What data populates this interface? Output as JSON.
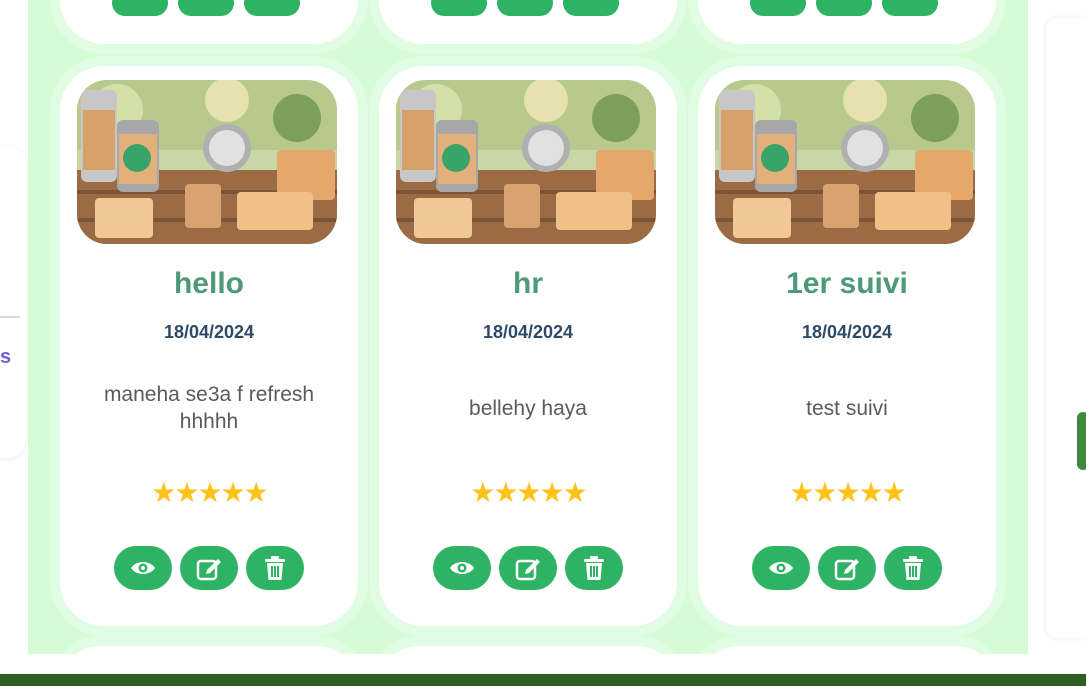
{
  "cards": [
    {
      "title": "hello",
      "date": "18/04/2024",
      "description": "maneha se3a  f refresh hhhhh",
      "rating": "★★★★★",
      "actions": [
        "eye-icon",
        "edit-icon",
        "trash-icon"
      ]
    },
    {
      "title": "hr",
      "date": "18/04/2024",
      "description": "bellehy haya",
      "rating": "★★★★★",
      "actions": [
        "eye-icon",
        "edit-icon",
        "trash-icon"
      ]
    },
    {
      "title": "1er suivi",
      "date": "18/04/2024",
      "description": "test suivi",
      "rating": "★★★★★",
      "actions": [
        "eye-icon",
        "edit-icon",
        "trash-icon"
      ]
    }
  ],
  "left_panel": {
    "partial_text": "s"
  },
  "colors": {
    "grid_background": "#d5fbd7",
    "title": "#4d9a78",
    "date": "#2f4a66",
    "button": "#2eb365",
    "star": "#ffc21a",
    "bottom_bar": "#2f5e22"
  }
}
